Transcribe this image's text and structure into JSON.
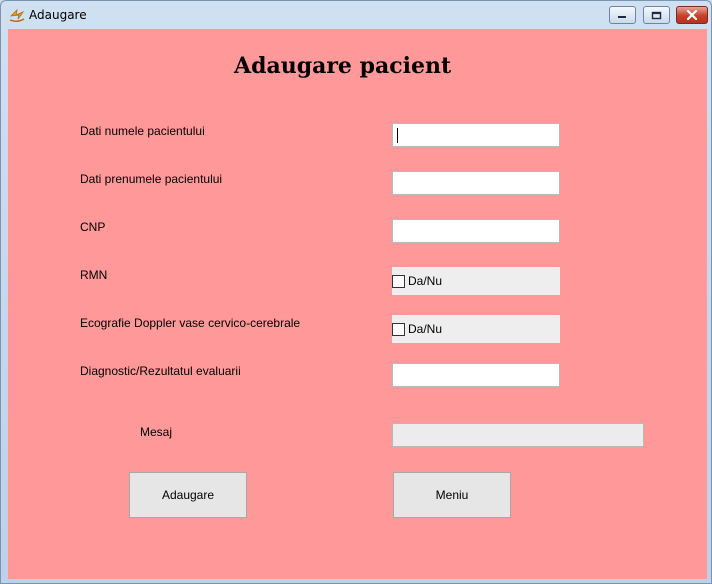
{
  "window": {
    "title": "Adaugare"
  },
  "form": {
    "heading": "Adaugare pacient",
    "fields": [
      {
        "label": "Dati numele pacientului",
        "value": ""
      },
      {
        "label": "Dati prenumele pacientului",
        "value": ""
      },
      {
        "label": "CNP",
        "value": ""
      },
      {
        "label": "RMN",
        "checkbox_label": "Da/Nu",
        "checked": false
      },
      {
        "label": "Ecografie Doppler vase cervico-cerebrale",
        "checkbox_label": "Da/Nu",
        "checked": false
      },
      {
        "label": "Diagnostic/Rezultatul evaluarii",
        "value": ""
      }
    ],
    "message_label": "Mesaj",
    "message_value": ""
  },
  "buttons": {
    "add_label": "Adaugare",
    "menu_label": "Meniu"
  },
  "colors": {
    "background": "#ff9999",
    "panel": "#eeeeee",
    "button": "#e6e6e6"
  }
}
